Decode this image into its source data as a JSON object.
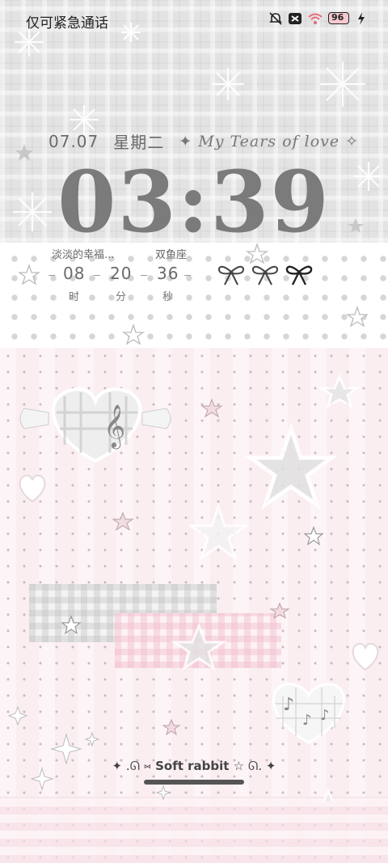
{
  "status_bar": {
    "carrier_text": "仅可紧急通话",
    "battery_level": "96",
    "icons": [
      "mute-icon",
      "no-sim-icon",
      "wifi-icon",
      "battery-icon",
      "charging-icon"
    ]
  },
  "lockscreen": {
    "date": "07.07",
    "weekday": "星期二",
    "decoration_text": "My Tears of love",
    "time": "03:39"
  },
  "countdown_widget": {
    "title": "淡淡的幸福...",
    "subtitle": "双鱼座",
    "hours": "08",
    "minutes": "20",
    "seconds": "36",
    "hours_unit": "时",
    "minutes_unit": "分",
    "seconds_unit": "秒"
  },
  "wallpaper": {
    "caption": "Soft rabbit"
  },
  "colors": {
    "time_gray": "#7b7b7b",
    "pink_bg": "#fbeef1",
    "plaid_gray": "#e3e3e3"
  }
}
